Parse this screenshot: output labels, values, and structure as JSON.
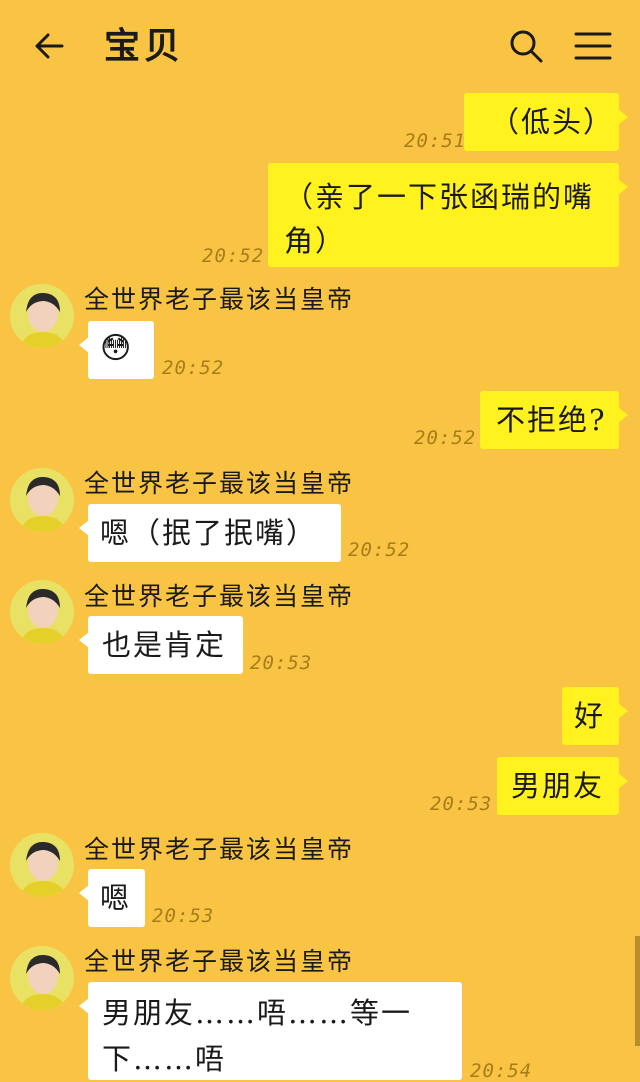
{
  "header": {
    "title": "宝贝"
  },
  "colors": {
    "background": "#f9c443",
    "my_bubble": "#fff21f",
    "other_bubble": "#ffffff"
  },
  "icons": {
    "back": "arrow-left-icon",
    "search": "search-icon",
    "menu": "hamburger-menu-icon"
  },
  "contact": {
    "name": "全世界老子最该当皇帝"
  },
  "messages": [
    {
      "from": "me",
      "text": "（低头）",
      "time": "20:51"
    },
    {
      "from": "me",
      "line1": "（亲了一下张函瑞的嘴",
      "line2": "角）",
      "time": "20:52"
    },
    {
      "from": "other",
      "text": "😳",
      "time": "20:52"
    },
    {
      "from": "me",
      "text": "不拒绝?",
      "time": "20:52"
    },
    {
      "from": "other",
      "text": "嗯（抿了抿嘴）",
      "time": "20:52"
    },
    {
      "from": "other",
      "text": "也是肯定",
      "time": "20:53"
    },
    {
      "from": "me",
      "text": "好"
    },
    {
      "from": "me",
      "text": "男朋友",
      "time": "20:53"
    },
    {
      "from": "other",
      "text": "嗯",
      "time": "20:53"
    },
    {
      "from": "other",
      "line1": "男朋友……唔……等一",
      "line2": "下……唔",
      "time": "20:54"
    }
  ]
}
